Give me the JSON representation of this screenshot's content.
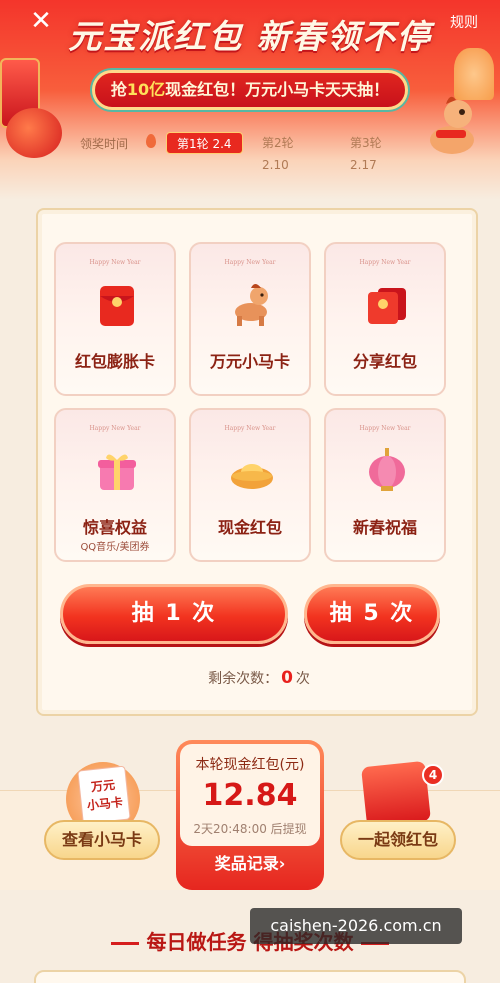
{
  "header": {
    "close_icon": "✕",
    "rules_label": "规则",
    "title": "元宝派红包 新春领不停",
    "banner_prefix": "抢",
    "banner_highlight": "10亿",
    "banner_suffix": "现金红包！万元小马卡天天抽！",
    "round_label": "领奖时间",
    "rounds": [
      {
        "label": "第1轮 2.4",
        "active": true
      },
      {
        "label": "第2轮 2.10",
        "active": false
      },
      {
        "label": "第3轮 2.17",
        "active": false
      }
    ]
  },
  "prizes": [
    {
      "name": "红包膨胀卡",
      "subtitle": "Happy New Year",
      "icon": "red-envelope-icon",
      "note": ""
    },
    {
      "name": "万元小马卡",
      "subtitle": "Happy New Year",
      "icon": "pony-icon",
      "note": ""
    },
    {
      "name": "分享红包",
      "subtitle": "Happy New Year",
      "icon": "share-envelope-icon",
      "note": ""
    },
    {
      "name": "惊喜权益",
      "subtitle": "Happy New Year",
      "icon": "gift-box-icon",
      "note": "QQ音乐/美团券"
    },
    {
      "name": "现金红包",
      "subtitle": "Happy New Year",
      "icon": "gold-ingot-icon",
      "note": ""
    },
    {
      "name": "新春祝福",
      "subtitle": "Happy New Year",
      "icon": "lantern-icon",
      "note": ""
    }
  ],
  "actions": {
    "draw_one": "抽 1 次",
    "draw_five": "抽 5 次",
    "remaining_prefix": "剩余次数：",
    "remaining_count": "0",
    "remaining_suffix": "次"
  },
  "bottom": {
    "view_cards": "查看小马卡",
    "horse_card_text": "万元\n小马卡",
    "collect": "一起领红包",
    "badge_count": "4",
    "cash_title": "本轮现金红包(元)",
    "cash_amount": "12.84",
    "countdown": "2天20:48:00 后提现",
    "record_label": "奖品记录›"
  },
  "task_title": "每日做任务 得抽奖次数",
  "watermark": "caishen-2026.com.cn",
  "colors": {
    "primary_red": "#e8291f",
    "gold": "#ffd98a",
    "background": "#f7ede0"
  }
}
